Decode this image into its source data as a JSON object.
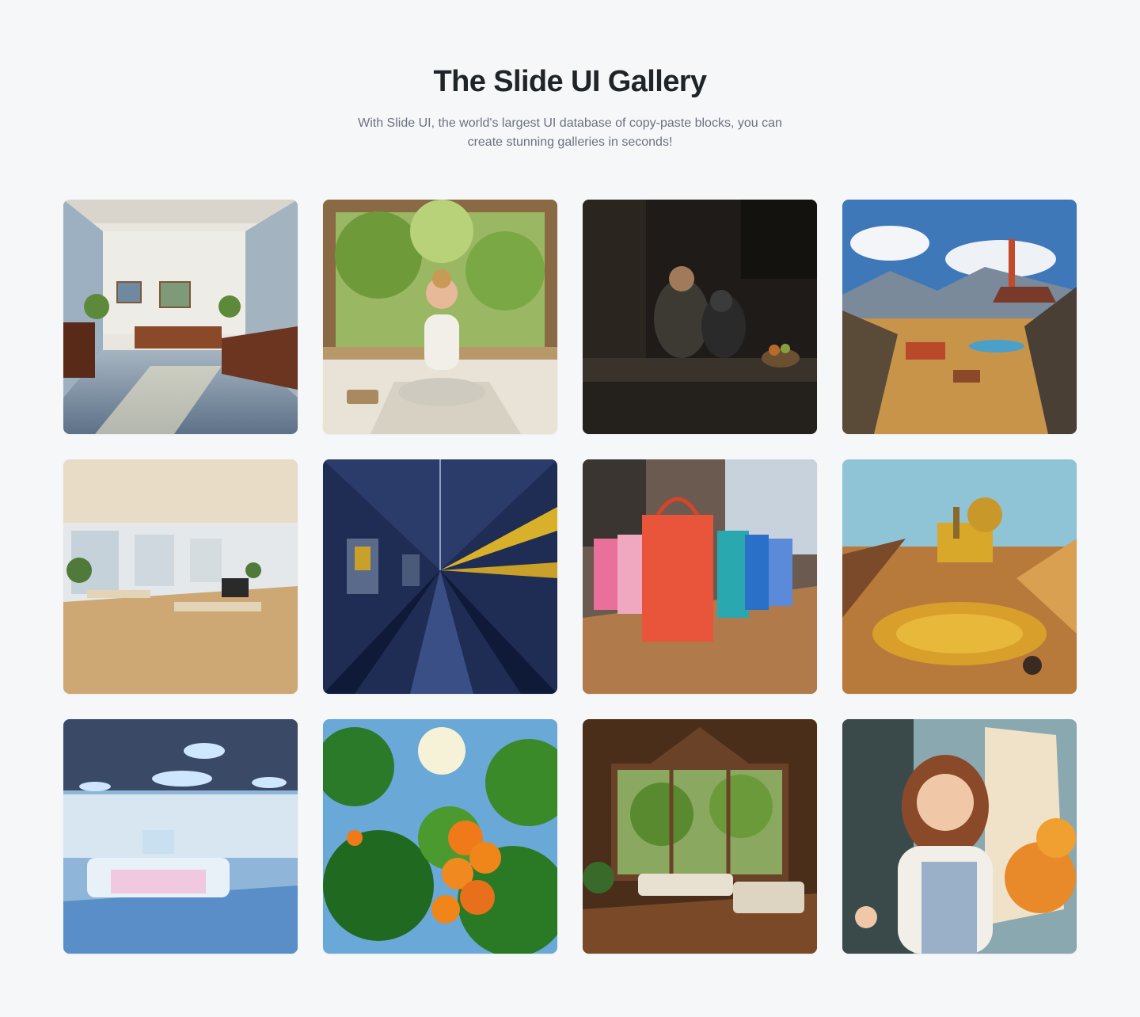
{
  "header": {
    "title": "The Slide UI Gallery",
    "subtitle": "With Slide UI, the world's largest UI database of copy-paste blocks, you can create stunning galleries in seconds!"
  },
  "colors": {
    "background": "#f6f7f9",
    "title": "#1f2428",
    "subtitle": "#6b7280"
  },
  "gallery": {
    "columns": 4,
    "rows": 3,
    "items": [
      {
        "name": "sunlit-office-lounge-image"
      },
      {
        "name": "woman-meditating-image"
      },
      {
        "name": "man-with-dog-image"
      },
      {
        "name": "mining-landscape-image"
      },
      {
        "name": "bright-open-office-image"
      },
      {
        "name": "factory-assembly-line-image"
      },
      {
        "name": "glossy-shopping-bags-image"
      },
      {
        "name": "golden-mining-machine-image"
      },
      {
        "name": "futuristic-lab-image"
      },
      {
        "name": "orange-tree-image"
      },
      {
        "name": "wooden-cabin-interior-image"
      },
      {
        "name": "smiling-painter-image"
      }
    ]
  }
}
